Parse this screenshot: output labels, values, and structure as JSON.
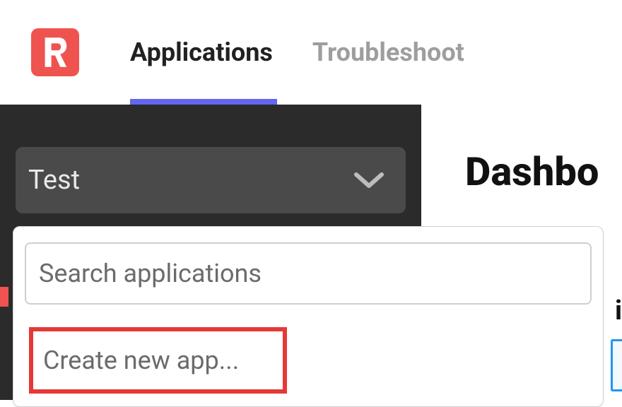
{
  "header": {
    "nav": {
      "applications_label": "Applications",
      "troubleshoot_label": "Troubleshoot"
    }
  },
  "sidebar": {
    "selector": {
      "selected_label": "Test"
    }
  },
  "dropdown": {
    "search_placeholder": "Search applications",
    "create_label": "Create new app..."
  },
  "main": {
    "title_fragment": "Dashbo",
    "subtext_fragment": "i"
  }
}
